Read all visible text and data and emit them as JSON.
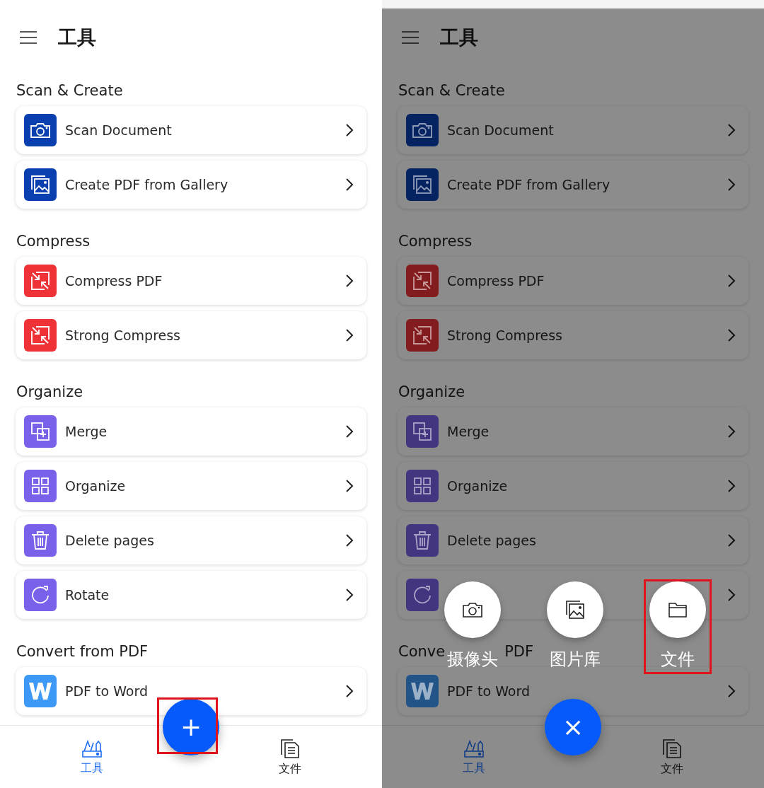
{
  "screens": [
    {
      "dimmed": false,
      "title": "工具",
      "sections": [
        {
          "title": "Scan & Create",
          "items": [
            {
              "kind": "scan",
              "label": "Scan Document",
              "color": "#0a3fb0"
            },
            {
              "kind": "gallery",
              "label": "Create PDF from Gallery",
              "color": "#0a3fb0"
            }
          ]
        },
        {
          "title": "Compress",
          "items": [
            {
              "kind": "compress",
              "label": "Compress PDF",
              "color": "#ee3236"
            },
            {
              "kind": "compress",
              "label": "Strong Compress",
              "color": "#ee3236"
            }
          ]
        },
        {
          "title": "Organize",
          "items": [
            {
              "kind": "merge",
              "label": "Merge",
              "color": "#7b61ea"
            },
            {
              "kind": "organize",
              "label": "Organize",
              "color": "#7b61ea"
            },
            {
              "kind": "delete",
              "label": "Delete pages",
              "color": "#7b61ea"
            },
            {
              "kind": "rotate",
              "label": "Rotate",
              "color": "#7b61ea"
            }
          ]
        },
        {
          "title": "Convert from PDF",
          "items": [
            {
              "kind": "word",
              "label": "PDF to Word",
              "color": "#3e98f5"
            }
          ]
        }
      ],
      "fab": {
        "symbol": "+",
        "highlighted": true
      },
      "nav": [
        {
          "kind": "tools",
          "label": "工具",
          "selected": true
        },
        {
          "kind": "files",
          "label": "文件",
          "selected": false
        }
      ]
    },
    {
      "dimmed": true,
      "title": "工具",
      "sections": [
        {
          "title": "Scan & Create",
          "items": [
            {
              "kind": "scan",
              "label": "Scan Document",
              "color": "#062361"
            },
            {
              "kind": "gallery",
              "label": "Create PDF from Gallery",
              "color": "#062361"
            }
          ]
        },
        {
          "title": "Compress",
          "items": [
            {
              "kind": "compress",
              "label": "Compress PDF",
              "color": "#831c1e"
            },
            {
              "kind": "compress",
              "label": "Strong Compress",
              "color": "#831c1e"
            }
          ]
        },
        {
          "title": "Organize",
          "items": [
            {
              "kind": "merge",
              "label": "Merge",
              "color": "#443581"
            },
            {
              "kind": "organize",
              "label": "Organize",
              "color": "#443581"
            },
            {
              "kind": "delete",
              "label": "Delete pages",
              "color": "#443581"
            },
            {
              "kind": "rotate",
              "color": "#443581"
            }
          ]
        },
        {
          "title": "Conve",
          "title_end": "PDF",
          "items": [
            {
              "kind": "word",
              "label": "PDF to Word",
              "color": "#225487"
            }
          ]
        }
      ],
      "menu": [
        {
          "kind": "camera",
          "label": "摄像头",
          "highlighted": false
        },
        {
          "kind": "gallery",
          "label": "图片库",
          "highlighted": false
        },
        {
          "kind": "folder",
          "label": "文件",
          "highlighted": true
        }
      ],
      "fab": {
        "symbol": "×",
        "highlighted": false
      },
      "nav": [
        {
          "kind": "tools",
          "label": "工具",
          "selected": true
        },
        {
          "kind": "files",
          "label": "文件",
          "selected": false
        }
      ]
    }
  ]
}
